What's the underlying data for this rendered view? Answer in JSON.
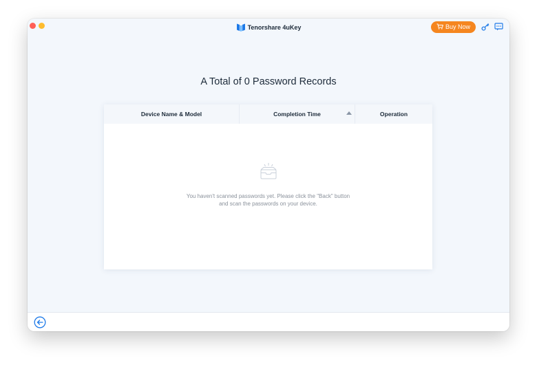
{
  "app": {
    "title": "Tenorshare 4uKey",
    "logo_icon": "4ukey-logo-icon"
  },
  "header": {
    "buy_label": "Buy Now",
    "buy_icon": "cart-icon",
    "key_icon": "key-icon",
    "feedback_icon": "feedback-icon"
  },
  "main": {
    "title": "A Total of 0 Password Records",
    "table": {
      "columns": [
        "Device Name & Model",
        "Completion Time",
        "Operation"
      ],
      "sort_icon": "sort-up-icon",
      "rows": []
    },
    "empty": {
      "icon": "empty-box-icon",
      "line1": "You haven't scanned passwords yet. Please click the \"Back\" button",
      "line2": "and scan the passwords on your device."
    }
  },
  "footer": {
    "back_icon": "back-arrow-icon"
  },
  "colors": {
    "accent": "#1e7ae8",
    "buy_button": "#f5861f",
    "window_bg": "#f3f7fc",
    "close": "#ff5f57",
    "minimize": "#febc2e"
  }
}
